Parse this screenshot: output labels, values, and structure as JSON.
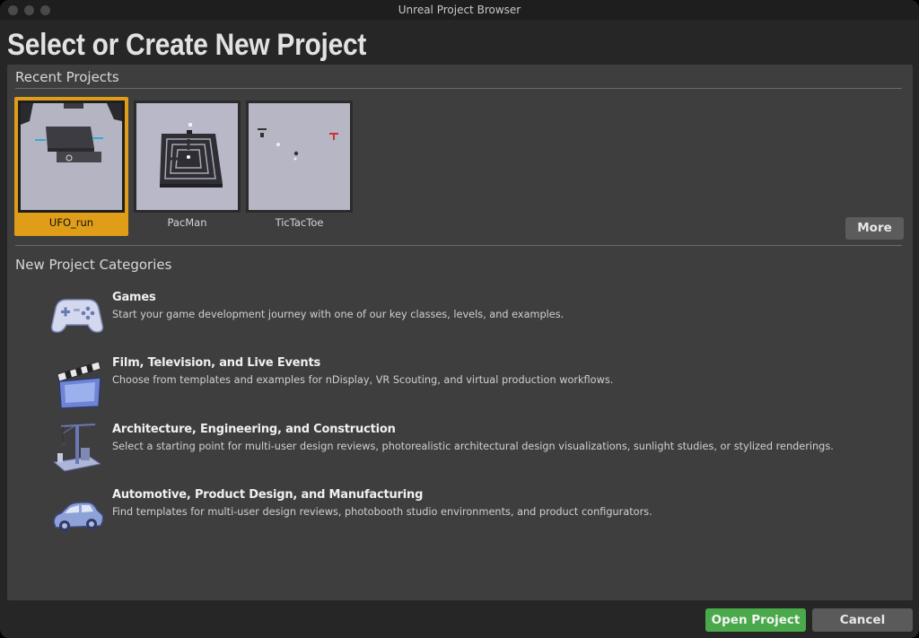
{
  "window": {
    "title": "Unreal Project Browser"
  },
  "heading": "Select or Create New Project",
  "recent": {
    "section_label": "Recent Projects",
    "projects": [
      {
        "name": "UFO_run",
        "selected": true
      },
      {
        "name": "PacMan",
        "selected": false
      },
      {
        "name": "TicTacToe",
        "selected": false
      }
    ],
    "more_label": "More"
  },
  "categories": {
    "section_label": "New Project Categories",
    "items": [
      {
        "title": "Games",
        "description": "Start your game development journey with one of our key classes, levels, and examples.",
        "icon": "gamepad-icon"
      },
      {
        "title": "Film, Television, and Live Events",
        "description": "Choose from templates and examples for nDisplay, VR Scouting, and virtual production workflows.",
        "icon": "clapperboard-icon"
      },
      {
        "title": "Architecture, Engineering, and Construction",
        "description": "Select a starting point for multi-user design reviews, photorealistic architectural design visualizations, sunlight studies, or stylized renderings.",
        "icon": "crane-icon"
      },
      {
        "title": "Automotive, Product Design, and Manufacturing",
        "description": "Find templates for multi-user design reviews, photobooth studio environments, and product configurators.",
        "icon": "car-icon"
      }
    ]
  },
  "footer": {
    "open_label": "Open Project",
    "cancel_label": "Cancel"
  },
  "colors": {
    "accent_selected": "#e09e18",
    "open_button": "#4aa94a",
    "panel": "#3e3e3e",
    "background": "#262626"
  }
}
